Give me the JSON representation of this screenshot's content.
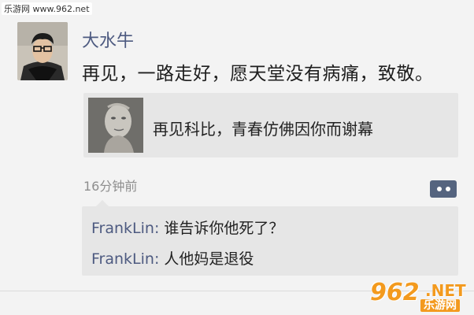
{
  "watermark": "乐游网 www.962.net",
  "post": {
    "username": "大水牛",
    "text": "再见，一路走好，愿天堂没有病痛，致敬。",
    "share": {
      "title": "再见科比，青春仿佛因你而谢幕"
    },
    "timestamp": "16分钟前"
  },
  "comments": [
    {
      "name": "FrankLin:",
      "text": " 谁告诉你他死了？"
    },
    {
      "name": "FrankLin:",
      "text": " 人他妈是退役"
    }
  ],
  "logo": {
    "main": "962",
    "net": ".NET",
    "cn": "乐游网"
  }
}
